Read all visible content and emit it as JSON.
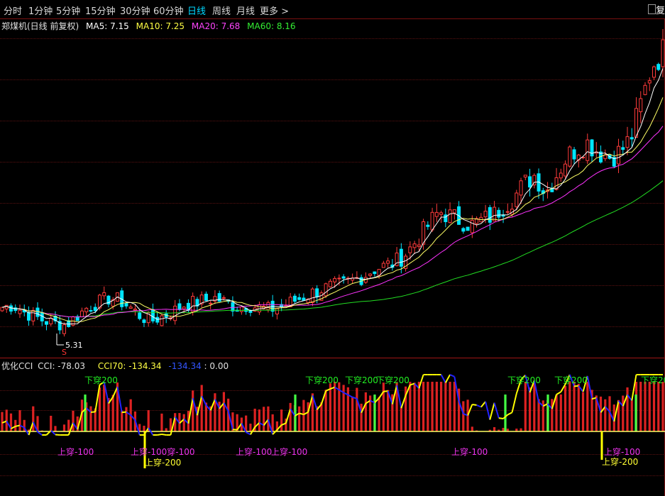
{
  "toolbar": {
    "tabs": [
      {
        "label": "分时"
      },
      {
        "label": "1分钟"
      },
      {
        "label": "5分钟"
      },
      {
        "label": "15分钟"
      },
      {
        "label": "30分钟"
      },
      {
        "label": "60分钟"
      },
      {
        "label": "日线"
      },
      {
        "label": "周线"
      },
      {
        "label": "月线"
      },
      {
        "label": "更多 >"
      }
    ],
    "active_tab": "日线",
    "corner_label": "复"
  },
  "main_legend": {
    "title": "郑煤机(日线 前复权)",
    "ma5": "MA5: 7.15",
    "ma10": "MA10: 7.25",
    "ma20": "MA20: 7.68",
    "ma60": "MA60: 8.16"
  },
  "colors": {
    "up": "#ff3b3b",
    "down": "#00e5ff",
    "ma5": "#ffffff",
    "ma10": "#ffff66",
    "ma20": "#ff33ff",
    "ma60": "#22dd22",
    "cci_line": "#ffff00",
    "cci_line_low": "#2222ff",
    "hist": "#dd2222",
    "hist_signal": "#44ff44"
  },
  "low_marker": {
    "label": "5.31",
    "s_mark": "S"
  },
  "cci_legend": {
    "name": "优化CCI",
    "cci": "CCI: -78.03",
    "cci70": "CCI70: -134.34",
    "cci_blue": "-134.34",
    "zero": ": 0.00"
  },
  "signals": {
    "cross_down_200": "下穿200",
    "cross_up_minus100": "上穿-100",
    "cross_up_minus200": "上穿-200",
    "cross_up_minus100_fused": "上穿-100穿-100"
  },
  "chart_data": {
    "type": "candlestick",
    "title": "郑煤机(日线 前复权)",
    "indicators": {
      "MA5": 7.15,
      "MA10": 7.25,
      "MA20": 7.68,
      "MA60": 8.16
    },
    "marked_low": 5.31,
    "close_trend": [
      5.7,
      5.75,
      5.6,
      5.5,
      5.4,
      5.35,
      5.31,
      5.5,
      5.7,
      5.8,
      5.9,
      5.85,
      5.7,
      5.5,
      5.4,
      5.5,
      5.6,
      5.75,
      5.8,
      5.85,
      5.9,
      5.8,
      5.7,
      5.75,
      5.7,
      5.65,
      5.7,
      5.8,
      5.9,
      6.0,
      6.1,
      6.15,
      6.2,
      6.3,
      6.4,
      6.55,
      6.6,
      6.7,
      6.9,
      7.2,
      7.5,
      7.8,
      7.7,
      7.6,
      7.5,
      7.6,
      7.7,
      7.9,
      8.1,
      8.4,
      8.6,
      8.2,
      8.6,
      9.0,
      9.2,
      9.3,
      9.1,
      9.0,
      9.1,
      9.4,
      10.2,
      11.0,
      11.3
    ],
    "cci_legend_values": {
      "CCI": -78.03,
      "CCI70": -134.34,
      "zero": 0.0
    }
  }
}
